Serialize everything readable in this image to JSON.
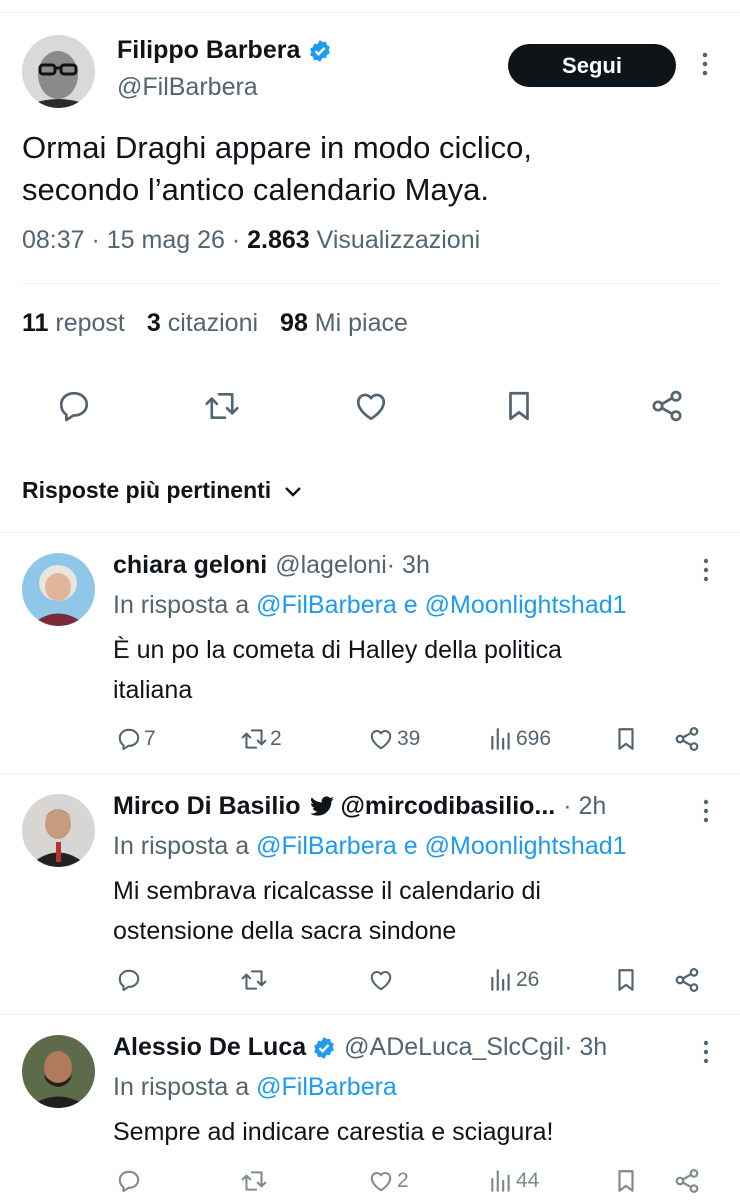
{
  "main_tweet": {
    "author_name": "Filippo Barbera",
    "author_handle": "@FilBarbera",
    "follow_label": "Segui",
    "text_line1": "Ormai Draghi appare in modo ciclico,",
    "text_line2": "secondo l’antico calendario Maya.",
    "time": "08:37 · 15 mag 26 · ",
    "views_count": "2.863",
    "views_label": " Visualizzazioni",
    "reposts_count": "11",
    "reposts_label": " repost",
    "quotes_count": "3",
    "quotes_label": " citazioni",
    "likes_count": "98",
    "likes_label": " Mi piace"
  },
  "sort_label": "Risposte più pertinenti",
  "replies": [
    {
      "name": "chiara geloni",
      "handle": "@lageloni",
      "time": " · 3h",
      "in_reply_prefix": "In risposta a ",
      "in_reply_to": "@FilBarbera e @Moonlightshad1",
      "text_line1": "È un po la cometa di Halley della politica",
      "text_line2": "italiana",
      "replies": "7",
      "reposts": "2",
      "likes": "39",
      "views": "696"
    },
    {
      "name": "Mirco Di Basilio",
      "handle": "@mircodibasilio...",
      "time": " · 2h",
      "in_reply_prefix": "In risposta a ",
      "in_reply_to": "@FilBarbera e @Moonlightshad1",
      "text_line1": "Mi sembrava ricalcasse il calendario di",
      "text_line2": "ostensione della sacra sindone",
      "views": "26"
    },
    {
      "name": "Alessio De Luca",
      "handle": "@ADeLuca_SlcCgil",
      "time": " · 3h",
      "in_reply_prefix": "In risposta a ",
      "in_reply_to": "@FilBarbera",
      "text_line1": "Sempre ad indicare carestia e sciagura!",
      "likes": "2",
      "views": "44"
    }
  ],
  "colors": {
    "accent": "#1d9bf0",
    "text": "#0f1419",
    "muted": "#536471",
    "divider": "#eff3f4"
  }
}
